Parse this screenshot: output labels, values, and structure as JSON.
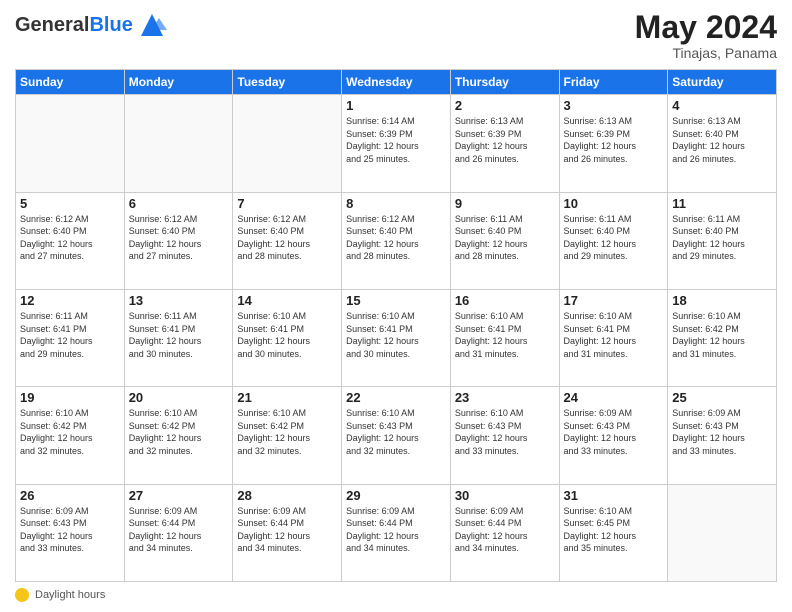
{
  "header": {
    "logo_general": "General",
    "logo_blue": "Blue",
    "month_title": "May 2024",
    "location": "Tinajas, Panama"
  },
  "footer": {
    "label": "Daylight hours"
  },
  "days_of_week": [
    "Sunday",
    "Monday",
    "Tuesday",
    "Wednesday",
    "Thursday",
    "Friday",
    "Saturday"
  ],
  "weeks": [
    {
      "days": [
        {
          "number": "",
          "detail": ""
        },
        {
          "number": "",
          "detail": ""
        },
        {
          "number": "",
          "detail": ""
        },
        {
          "number": "1",
          "detail": "Sunrise: 6:14 AM\nSunset: 6:39 PM\nDaylight: 12 hours\nand 25 minutes."
        },
        {
          "number": "2",
          "detail": "Sunrise: 6:13 AM\nSunset: 6:39 PM\nDaylight: 12 hours\nand 26 minutes."
        },
        {
          "number": "3",
          "detail": "Sunrise: 6:13 AM\nSunset: 6:39 PM\nDaylight: 12 hours\nand 26 minutes."
        },
        {
          "number": "4",
          "detail": "Sunrise: 6:13 AM\nSunset: 6:40 PM\nDaylight: 12 hours\nand 26 minutes."
        }
      ]
    },
    {
      "days": [
        {
          "number": "5",
          "detail": "Sunrise: 6:12 AM\nSunset: 6:40 PM\nDaylight: 12 hours\nand 27 minutes."
        },
        {
          "number": "6",
          "detail": "Sunrise: 6:12 AM\nSunset: 6:40 PM\nDaylight: 12 hours\nand 27 minutes."
        },
        {
          "number": "7",
          "detail": "Sunrise: 6:12 AM\nSunset: 6:40 PM\nDaylight: 12 hours\nand 28 minutes."
        },
        {
          "number": "8",
          "detail": "Sunrise: 6:12 AM\nSunset: 6:40 PM\nDaylight: 12 hours\nand 28 minutes."
        },
        {
          "number": "9",
          "detail": "Sunrise: 6:11 AM\nSunset: 6:40 PM\nDaylight: 12 hours\nand 28 minutes."
        },
        {
          "number": "10",
          "detail": "Sunrise: 6:11 AM\nSunset: 6:40 PM\nDaylight: 12 hours\nand 29 minutes."
        },
        {
          "number": "11",
          "detail": "Sunrise: 6:11 AM\nSunset: 6:40 PM\nDaylight: 12 hours\nand 29 minutes."
        }
      ]
    },
    {
      "days": [
        {
          "number": "12",
          "detail": "Sunrise: 6:11 AM\nSunset: 6:41 PM\nDaylight: 12 hours\nand 29 minutes."
        },
        {
          "number": "13",
          "detail": "Sunrise: 6:11 AM\nSunset: 6:41 PM\nDaylight: 12 hours\nand 30 minutes."
        },
        {
          "number": "14",
          "detail": "Sunrise: 6:10 AM\nSunset: 6:41 PM\nDaylight: 12 hours\nand 30 minutes."
        },
        {
          "number": "15",
          "detail": "Sunrise: 6:10 AM\nSunset: 6:41 PM\nDaylight: 12 hours\nand 30 minutes."
        },
        {
          "number": "16",
          "detail": "Sunrise: 6:10 AM\nSunset: 6:41 PM\nDaylight: 12 hours\nand 31 minutes."
        },
        {
          "number": "17",
          "detail": "Sunrise: 6:10 AM\nSunset: 6:41 PM\nDaylight: 12 hours\nand 31 minutes."
        },
        {
          "number": "18",
          "detail": "Sunrise: 6:10 AM\nSunset: 6:42 PM\nDaylight: 12 hours\nand 31 minutes."
        }
      ]
    },
    {
      "days": [
        {
          "number": "19",
          "detail": "Sunrise: 6:10 AM\nSunset: 6:42 PM\nDaylight: 12 hours\nand 32 minutes."
        },
        {
          "number": "20",
          "detail": "Sunrise: 6:10 AM\nSunset: 6:42 PM\nDaylight: 12 hours\nand 32 minutes."
        },
        {
          "number": "21",
          "detail": "Sunrise: 6:10 AM\nSunset: 6:42 PM\nDaylight: 12 hours\nand 32 minutes."
        },
        {
          "number": "22",
          "detail": "Sunrise: 6:10 AM\nSunset: 6:43 PM\nDaylight: 12 hours\nand 32 minutes."
        },
        {
          "number": "23",
          "detail": "Sunrise: 6:10 AM\nSunset: 6:43 PM\nDaylight: 12 hours\nand 33 minutes."
        },
        {
          "number": "24",
          "detail": "Sunrise: 6:09 AM\nSunset: 6:43 PM\nDaylight: 12 hours\nand 33 minutes."
        },
        {
          "number": "25",
          "detail": "Sunrise: 6:09 AM\nSunset: 6:43 PM\nDaylight: 12 hours\nand 33 minutes."
        }
      ]
    },
    {
      "days": [
        {
          "number": "26",
          "detail": "Sunrise: 6:09 AM\nSunset: 6:43 PM\nDaylight: 12 hours\nand 33 minutes."
        },
        {
          "number": "27",
          "detail": "Sunrise: 6:09 AM\nSunset: 6:44 PM\nDaylight: 12 hours\nand 34 minutes."
        },
        {
          "number": "28",
          "detail": "Sunrise: 6:09 AM\nSunset: 6:44 PM\nDaylight: 12 hours\nand 34 minutes."
        },
        {
          "number": "29",
          "detail": "Sunrise: 6:09 AM\nSunset: 6:44 PM\nDaylight: 12 hours\nand 34 minutes."
        },
        {
          "number": "30",
          "detail": "Sunrise: 6:09 AM\nSunset: 6:44 PM\nDaylight: 12 hours\nand 34 minutes."
        },
        {
          "number": "31",
          "detail": "Sunrise: 6:10 AM\nSunset: 6:45 PM\nDaylight: 12 hours\nand 35 minutes."
        },
        {
          "number": "",
          "detail": ""
        }
      ]
    }
  ]
}
